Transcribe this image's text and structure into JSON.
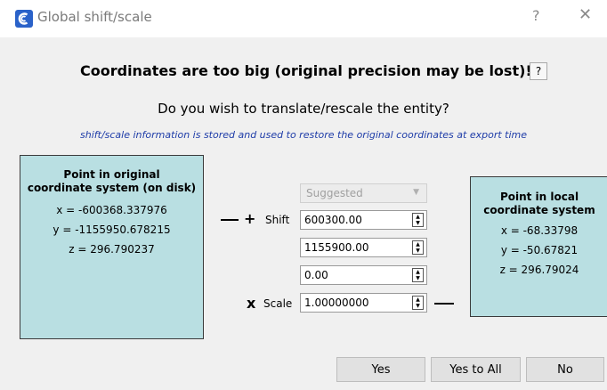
{
  "window": {
    "title": "Global shift/scale",
    "help_glyph": "?",
    "close_glyph": "✕"
  },
  "dialog": {
    "headline": "Coordinates are too big (original precision may be lost)!",
    "help_button": "?",
    "question": "Do you wish to translate/rescale the entity?",
    "info_note": "shift/scale information is stored and used to restore the original coordinates at export time"
  },
  "original_panel": {
    "title_line1": "Point in original",
    "title_line2": "coordinate system (on disk)",
    "x": "x = -600368.337976",
    "y": "y = -1155950.678215",
    "z": "z = 296.790237"
  },
  "local_panel": {
    "title_line1": "Point in local",
    "title_line2": "coordinate system",
    "x": "x = -68.33798",
    "y": "y = -50.67821",
    "z": "z = 296.79024"
  },
  "controls": {
    "preset_select": "Suggested",
    "shift_label": "Shift",
    "shift_symbol": "+",
    "shift_x": "600300.00",
    "shift_y": "1155900.00",
    "shift_z": "0.00",
    "scale_label": "Scale",
    "scale_symbol": "x",
    "scale_value": "1.00000000"
  },
  "buttons": {
    "yes": "Yes",
    "yes_to_all": "Yes to All",
    "no": "No"
  },
  "colors": {
    "panel_bg": "#b9dfe2",
    "note_text": "#1e3ca8",
    "app_icon": "#2a62c9"
  },
  "icons": [
    "cloudcompare-app-icon",
    "help-icon",
    "close-icon",
    "spin-up-icon",
    "spin-down-icon",
    "dropdown-arrow-icon"
  ]
}
